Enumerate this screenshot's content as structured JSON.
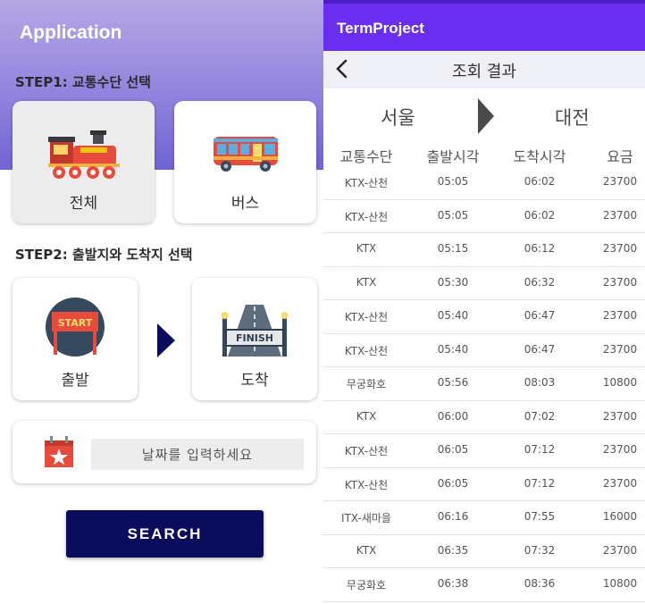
{
  "left": {
    "app_title": "Application",
    "step1_label": "STEP1: 교통수단 선택",
    "transport": [
      {
        "label": "전체",
        "icon": "train-icon",
        "selected": true
      },
      {
        "label": "버스",
        "icon": "bus-icon",
        "selected": false
      }
    ],
    "step2_label": "STEP2: 출발지와 도착지 선택",
    "departure_label": "출발",
    "departure_icon_text": "START",
    "arrival_label": "도착",
    "arrival_icon_text": "FINISH",
    "date_placeholder": "날짜를 입력하세요",
    "search_label": "SEARCH",
    "colors": {
      "header_gradient_top": "#b7a7e5",
      "header_gradient_bottom": "#6f64d5",
      "search_button": "#0c0c5c"
    }
  },
  "right": {
    "app_title": "TermProject",
    "screen_title": "조회 결과",
    "back_icon": "back-arrow-icon",
    "from": "서울",
    "to": "대전",
    "columns": [
      "교통수단",
      "출발시각",
      "도착시각",
      "요금"
    ],
    "rows": [
      [
        "KTX-산천",
        "05:05",
        "06:02",
        "23700"
      ],
      [
        "KTX-산천",
        "05:05",
        "06:02",
        "23700"
      ],
      [
        "KTX",
        "05:15",
        "06:12",
        "23700"
      ],
      [
        "KTX",
        "05:30",
        "06:32",
        "23700"
      ],
      [
        "KTX-산천",
        "05:40",
        "06:47",
        "23700"
      ],
      [
        "KTX-산천",
        "05:40",
        "06:47",
        "23700"
      ],
      [
        "무궁화호",
        "05:56",
        "08:03",
        "10800"
      ],
      [
        "KTX",
        "06:00",
        "07:02",
        "23700"
      ],
      [
        "KTX-산천",
        "06:05",
        "07:12",
        "23700"
      ],
      [
        "KTX-산천",
        "06:05",
        "07:12",
        "23700"
      ],
      [
        "ITX-새마을",
        "06:16",
        "07:55",
        "16000"
      ],
      [
        "KTX",
        "06:35",
        "07:32",
        "23700"
      ],
      [
        "무궁화호",
        "06:38",
        "08:36",
        "10800"
      ]
    ],
    "colors": {
      "appbar": "#6a2ef0",
      "statusbar": "#4b1bc4",
      "subbar": "#efeff6"
    }
  }
}
